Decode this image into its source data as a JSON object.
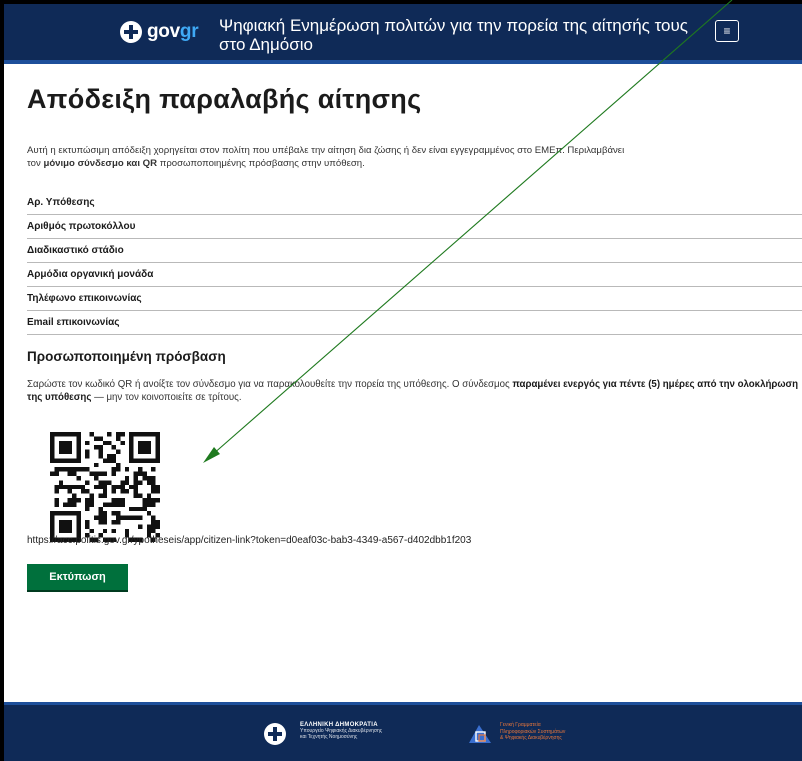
{
  "header": {
    "logo_gov": "gov",
    "logo_gr": "gr",
    "title": "Ψηφιακή Ενημέρωση πολιτών για την πορεία της αίτησής τους στο Δημόσιο",
    "menu_icon": "≡"
  },
  "page": {
    "heading": "Απόδειξη παραλαβής αίτησης",
    "intro_line1": "Αυτή η εκτυπώσιμη απόδειξη χορηγείται στον πολίτη που υπέβαλε την αίτηση δια ζώσης ή δεν είναι εγγεγραμμένος στο ΕΜΕπ. Περιλαμβάνει",
    "intro_line2_pre": "τον ",
    "intro_line2_bold": "μόνιμο σύνδεσμο και QR",
    "intro_line2_post": " προσωποποιημένης πρόσβασης στην υπόθεση."
  },
  "info_rows": [
    {
      "label": "Αρ. Υπόθεσης"
    },
    {
      "label": "Αριθμός πρωτοκόλλου"
    },
    {
      "label": "Διαδικαστικό στάδιο"
    },
    {
      "label": "Αρμόδια οργανική μονάδα"
    },
    {
      "label": "Τηλέφωνο επικοινωνίας"
    },
    {
      "label": "Email επικοινωνίας"
    }
  ],
  "access": {
    "heading": "Προσωποποιημένη πρόσβαση",
    "text_pre": "Σαρώστε τον κωδικό QR ή ανοίξτε τον σύνδεσμο για να παρακολουθείτε την πορεία της υπόθεσης. Ο σύνδεσμος ",
    "text_bold": "παραμένει ενεργός για πέντε (5) ημέρες από την ολοκλήρωση της υπόθεσης",
    "text_post": " — μην τον κοινοποιείτε σε τρίτους.",
    "link": "https://acc.politis.gov.gr/ypotheseis/app/citizen-link?token=d0eaf03c-bab3-4349-a567-d402dbb1f203",
    "print_label": "Εκτύπωση"
  },
  "footer": {
    "gov_line1": "ΕΛΛΗΝΙΚΗ ΔΗΜΟΚΡΑΤΙΑ",
    "gov_line2": "Υπουργείο Ψηφιακής Διακυβέρνησης",
    "gov_line3": "και Τεχνητής Νοημοσύνης",
    "gsis_line1": "Γενική Γραμματεία",
    "gsis_line2": "Πληροφοριακών Συστημάτων",
    "gsis_line3": "& Ψηφιακής Διακυβέρνησης"
  },
  "colors": {
    "header_bg": "#0f2a57",
    "accent_blue": "#1d4f9a",
    "gr_blue": "#3fa9f5",
    "print_button": "#00703c",
    "annotation_arrow": "#1f7a1f"
  }
}
